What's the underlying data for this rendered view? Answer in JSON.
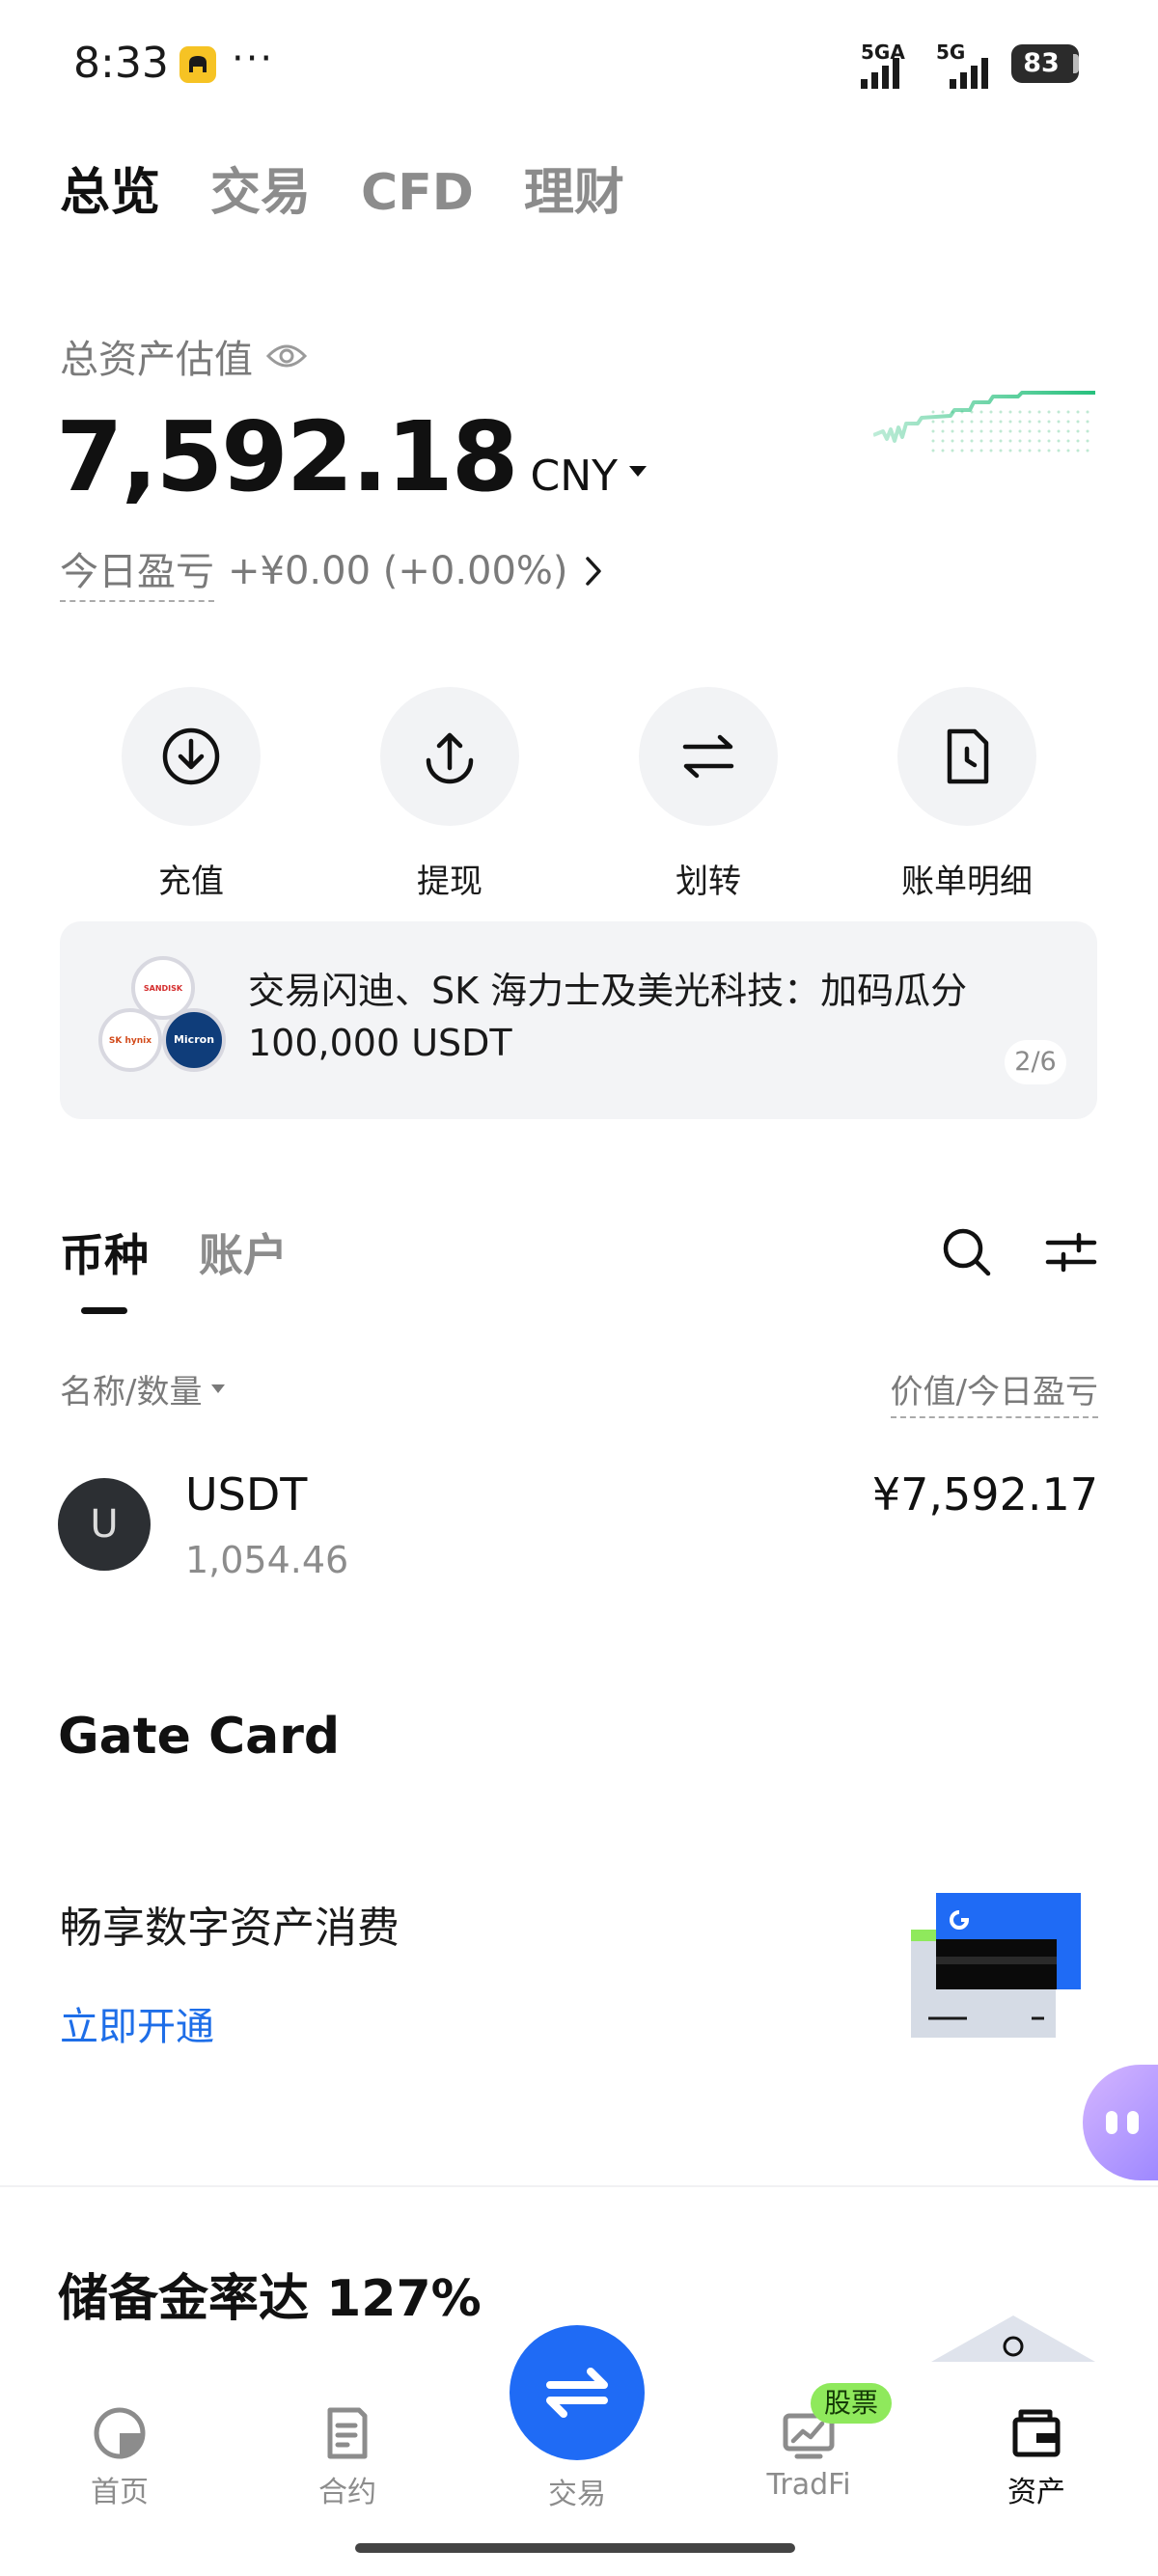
{
  "status_bar": {
    "time": "8:33",
    "dots": "···",
    "signal_1_label": "5GA",
    "signal_2_label": "5G",
    "battery": "83",
    "app_icon": "car-app-icon"
  },
  "top_tabs": [
    {
      "label": "总览",
      "active": true
    },
    {
      "label": "交易",
      "active": false
    },
    {
      "label": "CFD",
      "active": false
    },
    {
      "label": "理财",
      "active": false
    }
  ],
  "asset": {
    "label": "总资产估值",
    "value": "7,592.18",
    "currency": "CNY",
    "pnl_label": "今日盈亏",
    "pnl_value": "+¥0.00 (+0.00%)",
    "sparkline_color": "#27c07d"
  },
  "actions": [
    {
      "label": "充值",
      "icon": "download-icon"
    },
    {
      "label": "提现",
      "icon": "upload-icon"
    },
    {
      "label": "划转",
      "icon": "transfer-icon"
    },
    {
      "label": "账单明细",
      "icon": "bill-icon"
    }
  ],
  "banner": {
    "text_line1": "交易闪迪、SK 海力士及美光科技：加码瓜分",
    "text_line2": "100,000 USDT",
    "page": "2/6",
    "logo_1": "SANDISK",
    "logo_2": "SK hynix",
    "logo_3": "Micron"
  },
  "holdings": {
    "tabs": [
      {
        "label": "币种",
        "active": true
      },
      {
        "label": "账户",
        "active": false
      }
    ],
    "col_name": "名称/数量",
    "col_value": "价值/今日盈亏",
    "rows": [
      {
        "avatar": "U",
        "name": "USDT",
        "amount": "1,054.46",
        "value": "¥7,592.17"
      }
    ]
  },
  "gate_card": {
    "title": "Gate Card",
    "subtitle": "畅享数字资产消费",
    "link": "立即开通"
  },
  "reserve": {
    "title": "储备金率达 127%"
  },
  "bottom_nav": {
    "items": [
      {
        "label": "首页",
        "icon": "home-icon"
      },
      {
        "label": "合约",
        "icon": "contract-icon"
      },
      {
        "label": "交易",
        "icon": "trade-icon"
      },
      {
        "label": "TradFi",
        "icon": "tradfi-icon"
      },
      {
        "label": "资产",
        "icon": "wallet-icon",
        "active": true
      }
    ],
    "badge": "股票",
    "accent": "#1f6bf5"
  }
}
